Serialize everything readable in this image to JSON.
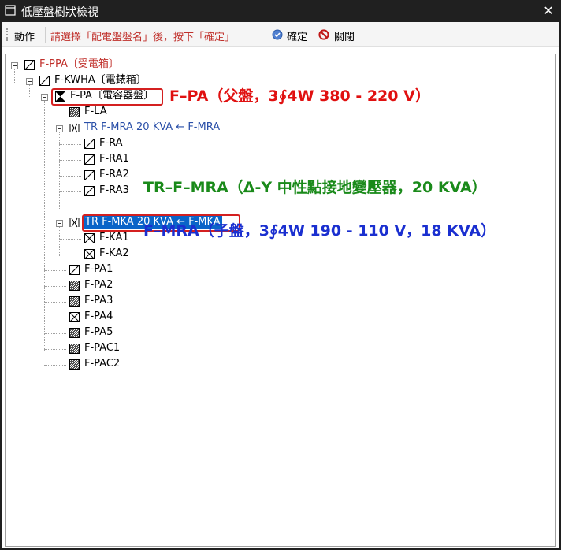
{
  "window": {
    "title": "低壓盤樹狀檢視",
    "close_glyph": "✕"
  },
  "toolbar": {
    "action_label": "動作",
    "hint": "請選擇「配電盤盤名」後，按下「確定」",
    "ok_label": "確定",
    "close_label": "關閉",
    "hint_color": "#c0302b"
  },
  "tree": {
    "nodes": [
      {
        "label": "F-PPA〔受電箱〕",
        "icon": "slash-box-icon"
      },
      {
        "label": "F-KWHA〔電錶箱〕",
        "icon": "slash-box-icon"
      },
      {
        "label": "F-PA〔電容器盤〕",
        "icon": "hourglass-box-icon"
      },
      {
        "label": "F-LA",
        "icon": "hatched-box-icon"
      },
      {
        "label": "TR F-MRA  20 KVA ← F-MRA",
        "icon": "transformer-icon"
      },
      {
        "label": "F-RA",
        "icon": "slash-box-icon"
      },
      {
        "label": "F-RA1",
        "icon": "slash-box-icon"
      },
      {
        "label": "F-RA2",
        "icon": "slash-box-icon"
      },
      {
        "label": "F-RA3",
        "icon": "slash-box-icon"
      },
      {
        "label": "TR F-MKA  20 KVA ← F-MKA",
        "icon": "transformer-icon"
      },
      {
        "label": "F-KA1",
        "icon": "cross-box-icon"
      },
      {
        "label": "F-KA2",
        "icon": "cross-box-icon"
      },
      {
        "label": "F-PA1",
        "icon": "slash-box-icon"
      },
      {
        "label": "F-PA2",
        "icon": "hatched-box-icon"
      },
      {
        "label": "F-PA3",
        "icon": "hatched-box-icon"
      },
      {
        "label": "F-PA4",
        "icon": "cross-box-icon"
      },
      {
        "label": "F-PA5",
        "icon": "hatched-box-icon"
      },
      {
        "label": "F-PAC1",
        "icon": "hatched-box-icon"
      },
      {
        "label": "F-PAC2",
        "icon": "hatched-box-icon"
      }
    ]
  },
  "annotations": {
    "parent_panel": "F–PA（父盤，3∮4W 380 - 220 V）",
    "transformer": "TR–F–MRA（Δ-Y 中性點接地變壓器，20 KVA）",
    "child_panel": "F–MRA（子盤，3∮4W  190 - 110 V，18 KVA）",
    "colors": {
      "red": "#e01010",
      "green": "#1a8a1a",
      "blue": "#1a2fd0"
    }
  }
}
